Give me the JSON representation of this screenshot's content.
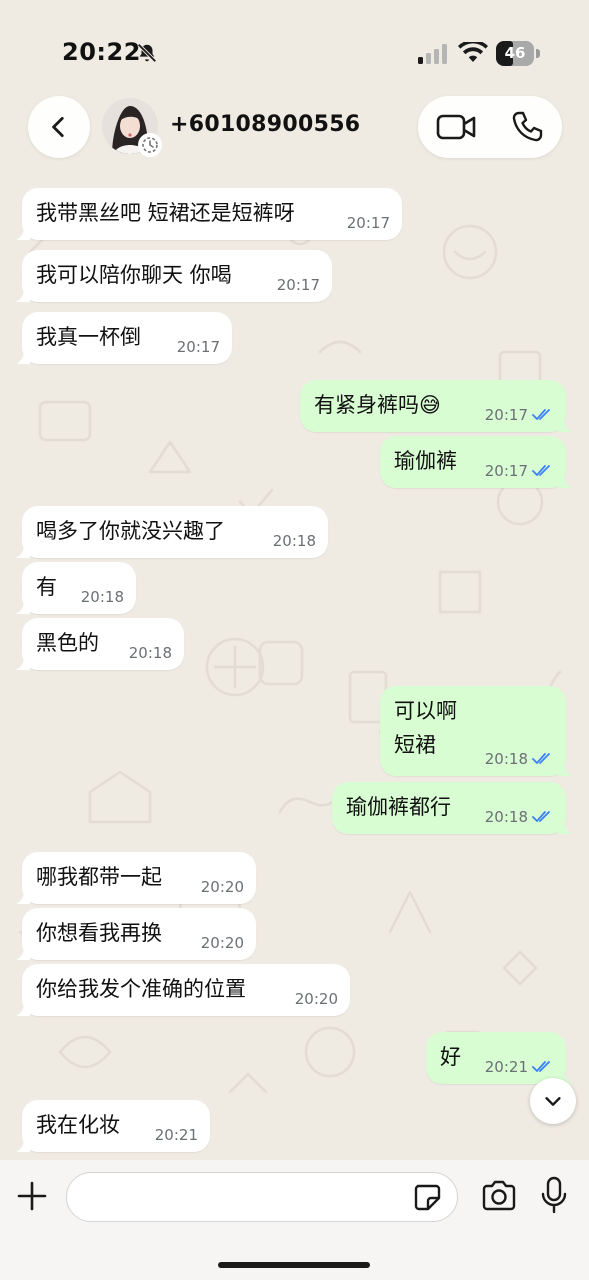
{
  "status_bar": {
    "time": "20:22",
    "battery": "46",
    "battery_level": 0.46
  },
  "header": {
    "contact": "+60108900556"
  },
  "messages": [
    {
      "dir": "in",
      "text": "我带黑丝吧 短裙还是短裤呀",
      "time": "20:17"
    },
    {
      "dir": "in",
      "text": "我可以陪你聊天 你喝",
      "time": "20:17"
    },
    {
      "dir": "in",
      "text": "我真一杯倒",
      "time": "20:17"
    },
    {
      "dir": "out",
      "text": "有紧身裤吗😅",
      "time": "20:17",
      "read": true
    },
    {
      "dir": "out",
      "text": "瑜伽裤",
      "time": "20:17",
      "read": true
    },
    {
      "dir": "in",
      "text": "喝多了你就没兴趣了",
      "time": "20:18"
    },
    {
      "dir": "in",
      "text": "有",
      "time": "20:18"
    },
    {
      "dir": "in",
      "text": "黑色的",
      "time": "20:18"
    },
    {
      "dir": "out",
      "text": "可以啊\n短裙",
      "time": "20:18",
      "read": true
    },
    {
      "dir": "out",
      "text": "瑜伽裤都行",
      "time": "20:18",
      "read": true
    },
    {
      "dir": "in",
      "text": "哪我都带一起",
      "time": "20:20"
    },
    {
      "dir": "in",
      "text": "你想看我再换",
      "time": "20:20"
    },
    {
      "dir": "in",
      "text": "你给我发个准确的位置",
      "time": "20:20"
    },
    {
      "dir": "out",
      "text": "好",
      "time": "20:21",
      "read": true
    },
    {
      "dir": "in",
      "text": "我在化妆",
      "time": "20:21"
    }
  ],
  "composer": {
    "value": ""
  },
  "colors": {
    "incoming": "#ffffff",
    "outgoing": "#d9fdd3",
    "read_check": "#3b82f6",
    "background": "#efeae2"
  }
}
